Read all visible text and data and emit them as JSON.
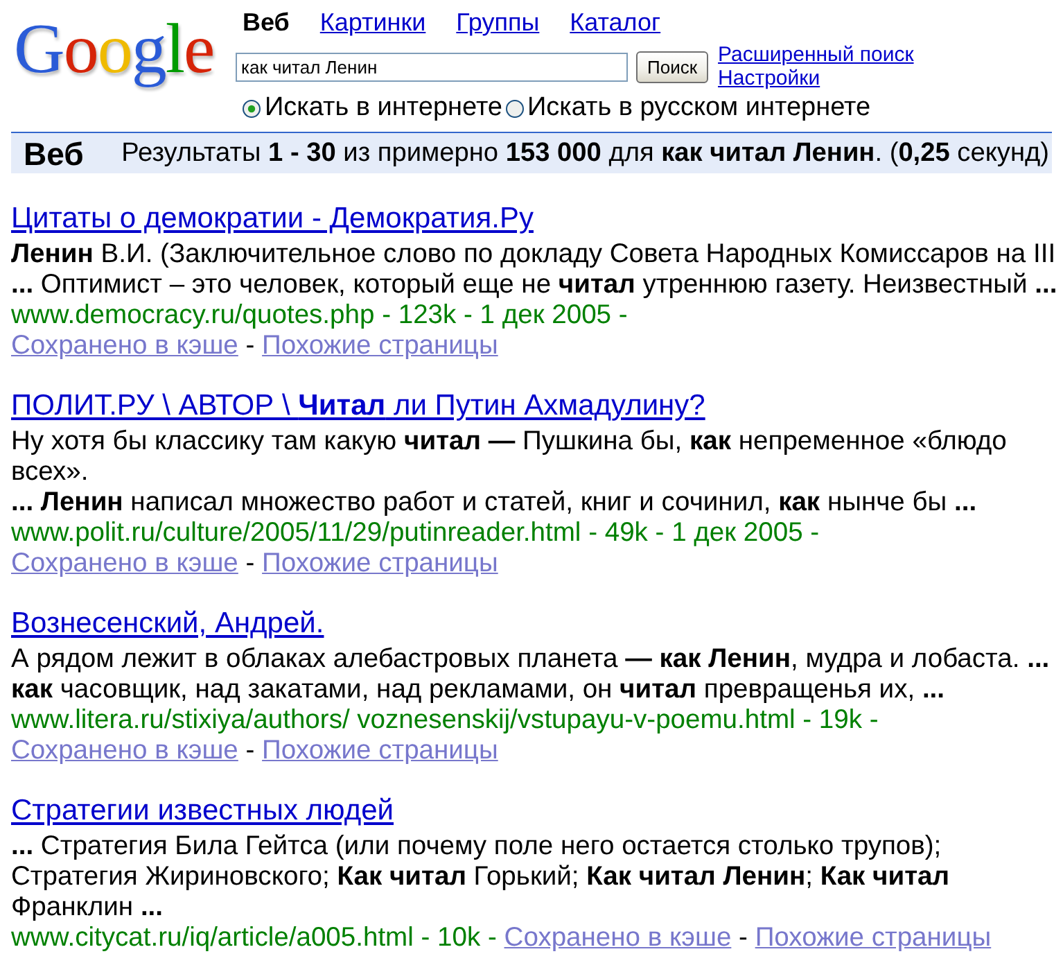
{
  "logo": "Google",
  "tabs": [
    {
      "label": "Веб",
      "selected": true
    },
    {
      "label": "Картинки",
      "selected": false
    },
    {
      "label": "Группы",
      "selected": false
    },
    {
      "label": "Каталог",
      "selected": false
    }
  ],
  "search": {
    "value": "как читал Ленин",
    "button": "Поиск"
  },
  "side_links": [
    "Расширенный поиск",
    "Настройки"
  ],
  "scope": [
    {
      "label": "Искать в интернете",
      "selected": true
    },
    {
      "label": "Искать в русском интернете",
      "selected": false
    }
  ],
  "results_bar": {
    "title": "Веб",
    "summary": "Результаты **1 - 30** из примерно **153 000** для **как читал Ленин**. (**0,25** секунд)"
  },
  "results": [
    {
      "title": "Цитаты о демократии - Демократия.Ру",
      "snippet": [
        "**Ленин** В.И. (Заключительное слово по докладу Совета Народных Комиссаров на III",
        "**...** Оптимист – это человек, который еще не **читал** утреннюю газету. Неизвестный **...**"
      ],
      "url_line": "www.democracy.ru/quotes.php - 123k - 1 дек 2005 -",
      "links": [
        {
          "kind": "link",
          "text": "Сохранено в кэше"
        },
        {
          "kind": "separator",
          "text": "-"
        },
        {
          "kind": "link",
          "text": "Похожие страницы"
        }
      ]
    },
    {
      "title": "ПОЛИТ.РУ \\ АВТОР \\ **Читал** ли Путин Ахмадулину?",
      "snippet": [
        "Ну хотя бы классику там какую **читал —** Пушкина бы, **как** непременное «блюдо всех».",
        "**... Ленин** написал множество работ и статей, книг и сочинил, **как** нынче бы **...**"
      ],
      "url_line": "www.polit.ru/culture/2005/11/29/putinreader.html - 49k - 1 дек 2005 -",
      "links": [
        {
          "kind": "link",
          "text": "Сохранено в кэше"
        },
        {
          "kind": "separator",
          "text": "-"
        },
        {
          "kind": "link",
          "text": "Похожие страницы"
        }
      ]
    },
    {
      "title": "Вознесенский, Андрей.",
      "snippet": [
        "А рядом лежит в облаках алебастровых планета **— как Ленин**, мудра и лобаста. **...**",
        "**как** часовщик, над закатами, над рекламами, он **читал** превращенья их, **...**"
      ],
      "url_line": "www.litera.ru/stixiya/authors/ voznesenskij/vstupayu-v-poemu.html - 19k -",
      "links": [
        {
          "kind": "link",
          "text": "Сохранено в кэше"
        },
        {
          "kind": "separator",
          "text": "-"
        },
        {
          "kind": "link",
          "text": "Похожие страницы"
        }
      ]
    },
    {
      "title": "Стратегии известных людей",
      "snippet": [
        "**...** Стратегия Била Гейтса (или почему поле него остается столько трупов);",
        "Стратегия Жириновского; **Как читал** Горький; **Как читал Ленин**; **Как читал** Франклин **...**"
      ],
      "url_line": "www.citycat.ru/iq/article/a005.html - 10k -",
      "links": [
        {
          "kind": "link",
          "text": "Сохранено в кэше"
        },
        {
          "kind": "separator",
          "text": "-"
        },
        {
          "kind": "link",
          "text": "Похожие страницы"
        }
      ]
    }
  ]
}
